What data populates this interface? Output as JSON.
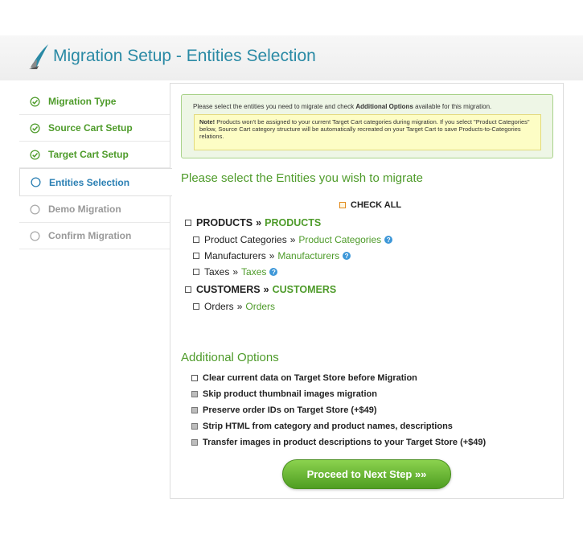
{
  "header": {
    "title": "Migration Setup - Entities Selection",
    "logo_icon": "migration-logo-icon"
  },
  "sidebar": {
    "steps": [
      {
        "label": "Migration Type",
        "state": "done"
      },
      {
        "label": "Source Cart Setup",
        "state": "done"
      },
      {
        "label": "Target Cart Setup",
        "state": "done"
      },
      {
        "label": "Entities Selection",
        "state": "active"
      },
      {
        "label": "Demo Migration",
        "state": "pending"
      },
      {
        "label": "Confirm Migration",
        "state": "pending"
      }
    ]
  },
  "info": {
    "text_before": "Please select the entities you need to migrate and check ",
    "text_bold": "Additional Options",
    "text_after": " available for this migration.",
    "note_label": "Note!",
    "note_text": " Products won't be assigned to your current Target Cart categories during migration. If you select \"Product Categories\" below, Source Cart category structure will be automatically recreated on your Target Cart to save Products-to-Categories relations."
  },
  "entities": {
    "title": "Please select the Entities you wish to migrate",
    "check_all": "CHECK ALL",
    "separator": "»",
    "products": {
      "source": "PRODUCTS",
      "target": "PRODUCTS"
    },
    "product_children": [
      {
        "source": "Product Categories",
        "target": "Product Categories",
        "help": true
      },
      {
        "source": "Manufacturers",
        "target": "Manufacturers",
        "help": true
      },
      {
        "source": "Taxes",
        "target": "Taxes",
        "help": true
      }
    ],
    "customers": {
      "source": "CUSTOMERS",
      "target": "CUSTOMERS"
    },
    "customer_children": [
      {
        "source": "Orders",
        "target": "Orders",
        "help": false
      }
    ]
  },
  "additional": {
    "title": "Additional Options",
    "options": [
      {
        "label": "Clear current data on Target Store before Migration",
        "style": "white"
      },
      {
        "label": "Skip product thumbnail images migration",
        "style": "grey"
      },
      {
        "label": "Preserve order IDs on Target Store (+$49)",
        "style": "grey"
      },
      {
        "label": "Strip HTML from category and product names, descriptions",
        "style": "grey"
      },
      {
        "label": "Transfer images in product descriptions to your Target Store (+$49)",
        "style": "grey"
      }
    ]
  },
  "proceed_label": "Proceed to Next Step »»",
  "colors": {
    "title_blue": "#2a8aa5",
    "green": "#4e9b2a",
    "active_blue": "#2a7fb3",
    "help_blue": "#3d97d8"
  }
}
